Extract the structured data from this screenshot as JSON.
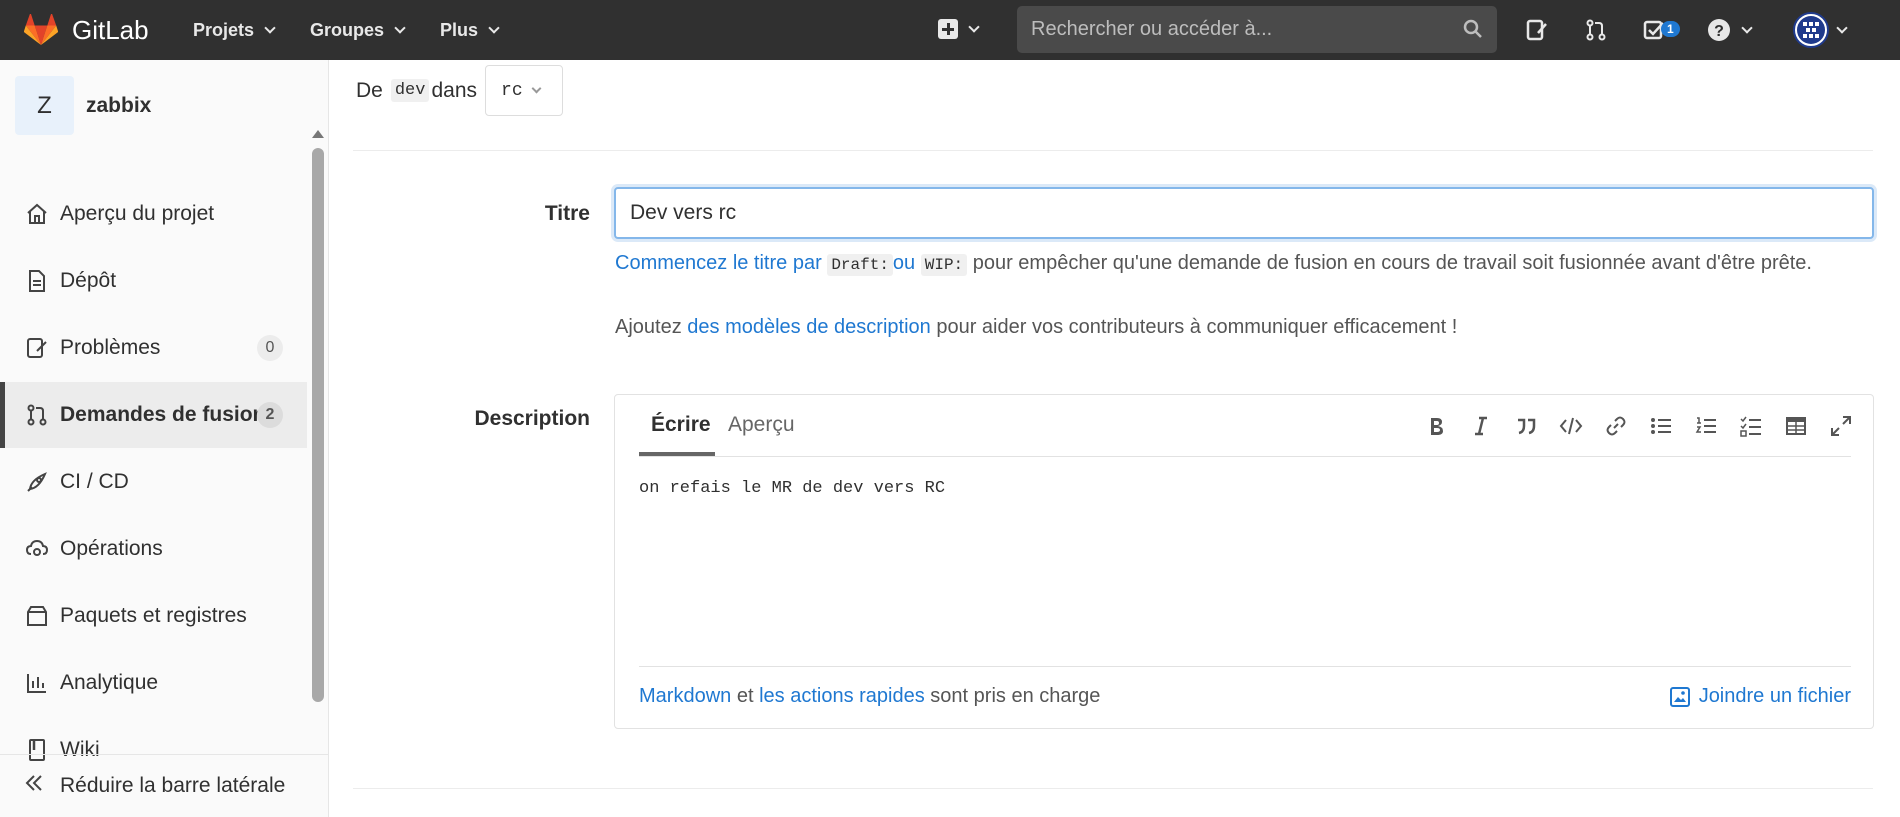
{
  "app": {
    "name": "GitLab"
  },
  "topnav": {
    "projects": "Projets",
    "groups": "Groupes",
    "more": "Plus"
  },
  "search": {
    "placeholder": "Rechercher ou accéder à..."
  },
  "todos": {
    "count": "1"
  },
  "project": {
    "initial": "Z",
    "name": "zabbix"
  },
  "sidebar": {
    "items": [
      {
        "label": "Aperçu du projet",
        "icon": "home-icon"
      },
      {
        "label": "Dépôt",
        "icon": "document-icon"
      },
      {
        "label": "Problèmes",
        "icon": "issues-icon",
        "badge": "0"
      },
      {
        "label": "Demandes de fusion",
        "icon": "merge-request-icon",
        "badge": "2",
        "active": true
      },
      {
        "label": "CI / CD",
        "icon": "rocket-icon"
      },
      {
        "label": "Opérations",
        "icon": "cloud-gear-icon"
      },
      {
        "label": "Paquets et registres",
        "icon": "package-icon"
      },
      {
        "label": "Analytique",
        "icon": "chart-icon"
      },
      {
        "label": "Wiki",
        "icon": "book-icon"
      }
    ],
    "collapse": "Réduire la barre latérale"
  },
  "branch": {
    "from_prefix": "De",
    "source": "dev",
    "into": "dans",
    "target": "rc"
  },
  "form": {
    "title_label": "Titre",
    "title_value": "Dev vers rc",
    "help_link": "Commencez le titre par",
    "draft": "Draft:",
    "or": "ou",
    "wip": "WIP:",
    "help_rest": "pour empêcher qu'une demande de fusion en cours de travail soit fusionnée avant d'être prête.",
    "templates_prefix": "Ajoutez",
    "templates_link": "des modèles de description",
    "templates_suffix": "pour aider vos contributeurs à communiquer efficacement !",
    "description_label": "Description"
  },
  "editor": {
    "tab_write": "Écrire",
    "tab_preview": "Aperçu",
    "content": "on refais le MR de dev vers RC",
    "markdown_link": "Markdown",
    "and": "et",
    "quick_actions_link": "les actions rapides",
    "supported": "sont pris en charge",
    "attach": "Joindre un fichier",
    "toolbar": [
      "bold-icon",
      "italic-icon",
      "quote-icon",
      "code-icon",
      "link-icon",
      "bullet-list-icon",
      "numbered-list-icon",
      "task-list-icon",
      "table-icon",
      "fullscreen-icon"
    ]
  },
  "colors": {
    "topbar": "#303030",
    "link": "#1f78d1",
    "focus": "#84b7ea",
    "badge": "#1f78d1"
  }
}
